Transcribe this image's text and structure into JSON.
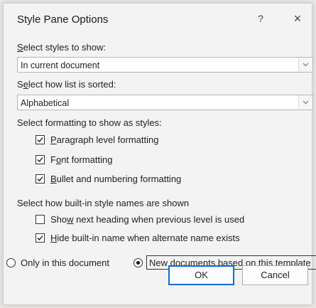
{
  "dialog": {
    "title": "Style Pane Options",
    "help_glyph": "?",
    "close_glyph": "×"
  },
  "select_styles": {
    "label_access": "S",
    "label_rest": "elect styles to show:",
    "value": "In current document"
  },
  "sort": {
    "label_pre": "S",
    "label_access": "e",
    "label_rest": "lect how list is sorted:",
    "value": "Alphabetical"
  },
  "formatting": {
    "label": "Select formatting to show as styles:",
    "options": [
      {
        "pre": "",
        "access": "P",
        "rest": "aragraph level formatting",
        "checked": true
      },
      {
        "pre": "F",
        "access": "o",
        "rest": "nt formatting",
        "checked": true
      },
      {
        "pre": "",
        "access": "B",
        "rest": "ullet and numbering formatting",
        "checked": true
      }
    ]
  },
  "builtin": {
    "label": "Select how built-in style names are shown",
    "options": [
      {
        "pre": "Sho",
        "access": "w",
        "rest": " next heading when previous level is used",
        "checked": false
      },
      {
        "pre": "",
        "access": "H",
        "rest": "ide built-in name when alternate name exists",
        "checked": true
      }
    ]
  },
  "scope": {
    "only_this": {
      "label": "Only in this document",
      "selected": false
    },
    "new_docs": {
      "label": "New documents based on this template",
      "selected": true
    }
  },
  "buttons": {
    "ok": "OK",
    "cancel": "Cancel"
  }
}
